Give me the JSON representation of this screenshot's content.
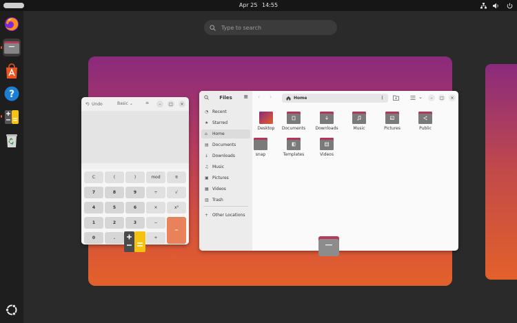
{
  "topbar": {
    "date": "Apr 25",
    "time": "14:55"
  },
  "search": {
    "placeholder": "Type to search"
  },
  "dock": {
    "items": [
      "firefox-icon",
      "files-icon",
      "app-center-icon",
      "help-icon",
      "calculator-icon",
      "trash-icon"
    ]
  },
  "calculator": {
    "undo_label": "Undo",
    "mode_label": "Basic",
    "keys": [
      [
        "C",
        "(",
        ")",
        "mod",
        "π"
      ],
      [
        "7",
        "8",
        "9",
        "÷",
        "√"
      ],
      [
        "4",
        "5",
        "6",
        "×",
        "x²"
      ],
      [
        "1",
        "2",
        "3",
        "−",
        "="
      ],
      [
        "0",
        ".",
        "%",
        "+",
        ""
      ]
    ]
  },
  "files": {
    "title": "Files",
    "path": "Home",
    "sidebar": [
      {
        "label": "Recent",
        "icon": "clock-icon"
      },
      {
        "label": "Starred",
        "icon": "star-icon"
      },
      {
        "label": "Home",
        "icon": "home-icon",
        "selected": true
      },
      {
        "label": "Documents",
        "icon": "document-icon"
      },
      {
        "label": "Downloads",
        "icon": "download-icon"
      },
      {
        "label": "Music",
        "icon": "music-icon"
      },
      {
        "label": "Pictures",
        "icon": "picture-icon"
      },
      {
        "label": "Videos",
        "icon": "video-icon"
      },
      {
        "label": "Trash",
        "icon": "trash-icon"
      },
      {
        "label": "Other Locations",
        "icon": "plus-icon"
      }
    ],
    "folders": [
      {
        "label": "Desktop"
      },
      {
        "label": "Documents"
      },
      {
        "label": "Downloads"
      },
      {
        "label": "Music"
      },
      {
        "label": "Pictures"
      },
      {
        "label": "Public"
      },
      {
        "label": "snap"
      },
      {
        "label": "Templates"
      },
      {
        "label": "Videos"
      }
    ]
  },
  "colors": {
    "accent": "#e95420",
    "folder": "#7a7a7a",
    "folder_tab": "#b0365a"
  }
}
